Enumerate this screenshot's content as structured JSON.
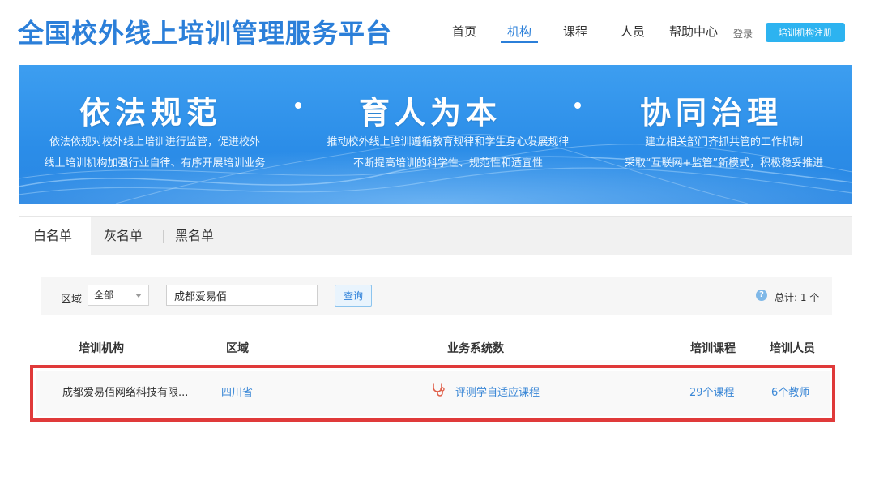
{
  "header": {
    "site_title": "全国校外线上培训管理服务平台",
    "nav": [
      {
        "label": "首页",
        "active": false
      },
      {
        "label": "机构",
        "active": true
      },
      {
        "label": "课程",
        "active": false
      },
      {
        "label": "人员",
        "active": false
      },
      {
        "label": "帮助中心",
        "active": false
      }
    ],
    "login_label": "登录",
    "register_label": "培训机构注册"
  },
  "banner": {
    "slogans": [
      "依法规范",
      "育人为本",
      "协同治理"
    ],
    "descriptions": [
      [
        "依法依规对校外线上培训进行监管，促进校外",
        "线上培训机构加强行业自律、有序开展培训业务"
      ],
      [
        "推动校外线上培训遵循教育规律和学生身心发展规律",
        "不断提高培训的科学性、规范性和适宜性"
      ],
      [
        "建立相关部门齐抓共管的工作机制",
        "采取“互联网+监管”新模式，积极稳妥推进"
      ]
    ]
  },
  "tabs": [
    {
      "label": "白名单",
      "active": true
    },
    {
      "label": "灰名单",
      "active": false
    },
    {
      "label": "黑名单",
      "active": false
    }
  ],
  "filter": {
    "region_label": "区域",
    "region_value": "全部",
    "search_value": "成都爱易佰",
    "query_label": "查询",
    "total_text": "总计: 1 个"
  },
  "table": {
    "headers": [
      "培训机构",
      "区域",
      "业务系统数",
      "培训课程",
      "培训人员"
    ],
    "rows": [
      {
        "org": "成都爱易佰网络科技有限...",
        "region": "四川省",
        "system": "评测学自适应课程",
        "courses": "29个课程",
        "staff": "6个教师"
      }
    ]
  },
  "colors": {
    "brand_blue": "#2b7fd9",
    "register_button": "#2db3f0",
    "highlight_red": "#e03a3a"
  }
}
